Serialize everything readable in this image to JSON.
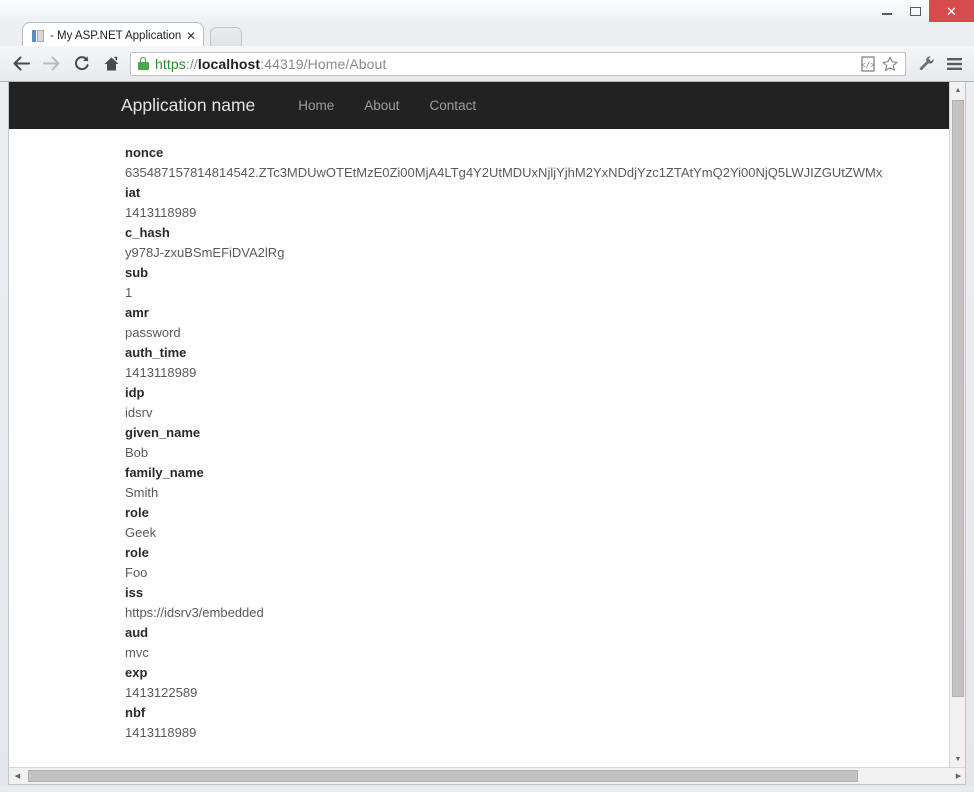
{
  "window": {
    "minimize_label": "minimize",
    "maximize_label": "maximize",
    "close_label": "✕"
  },
  "browser": {
    "tab": {
      "title": "- My ASP.NET Application",
      "close_label": "✕"
    },
    "new_tab_label": "",
    "nav": {
      "back_label": "Back",
      "forward_label": "Forward",
      "reload_label": "Reload",
      "home_label": "Home"
    },
    "omnibox": {
      "full_url": "https://localhost:44319/Home/About",
      "scheme": "https",
      "separator": "://",
      "host": "localhost",
      "rest": ":44319/Home/About",
      "lock_icon": "secure-lock-icon"
    },
    "toolbar_icons": [
      "page-actions-icon",
      "bookmark-star-icon",
      "customize-wrench-icon",
      "chrome-menu-icon"
    ]
  },
  "site": {
    "brand": "Application name",
    "navlinks": [
      {
        "label": "Home"
      },
      {
        "label": "About"
      },
      {
        "label": "Contact"
      }
    ]
  },
  "claims": [
    {
      "key": "nonce",
      "value": "635487157814814542.ZTc3MDUwOTEtMzE0Zi00MjA4LTg4Y2UtMDUxNjljYjhM2YxNDdjYzc1ZTAtYmQ2Yi00NjQ5LWJIZGUtZWMx"
    },
    {
      "key": "iat",
      "value": "1413118989"
    },
    {
      "key": "c_hash",
      "value": "y978J-zxuBSmEFiDVA2lRg"
    },
    {
      "key": "sub",
      "value": "1"
    },
    {
      "key": "amr",
      "value": "password"
    },
    {
      "key": "auth_time",
      "value": "1413118989"
    },
    {
      "key": "idp",
      "value": "idsrv"
    },
    {
      "key": "given_name",
      "value": "Bob"
    },
    {
      "key": "family_name",
      "value": "Smith"
    },
    {
      "key": "role",
      "value": "Geek"
    },
    {
      "key": "role",
      "value": "Foo"
    },
    {
      "key": "iss",
      "value": "https://idsrv3/embedded"
    },
    {
      "key": "aud",
      "value": "mvc"
    },
    {
      "key": "exp",
      "value": "1413122589"
    },
    {
      "key": "nbf",
      "value": "1413118989"
    }
  ],
  "scrollbars": {
    "vertical_up": "▲",
    "vertical_down": "▼",
    "horizontal_left": "◀",
    "horizontal_right": "▶"
  },
  "colors": {
    "navbar_bg": "#222222",
    "close_button": "#d64b4b",
    "url_secure": "#2e8a2e"
  }
}
